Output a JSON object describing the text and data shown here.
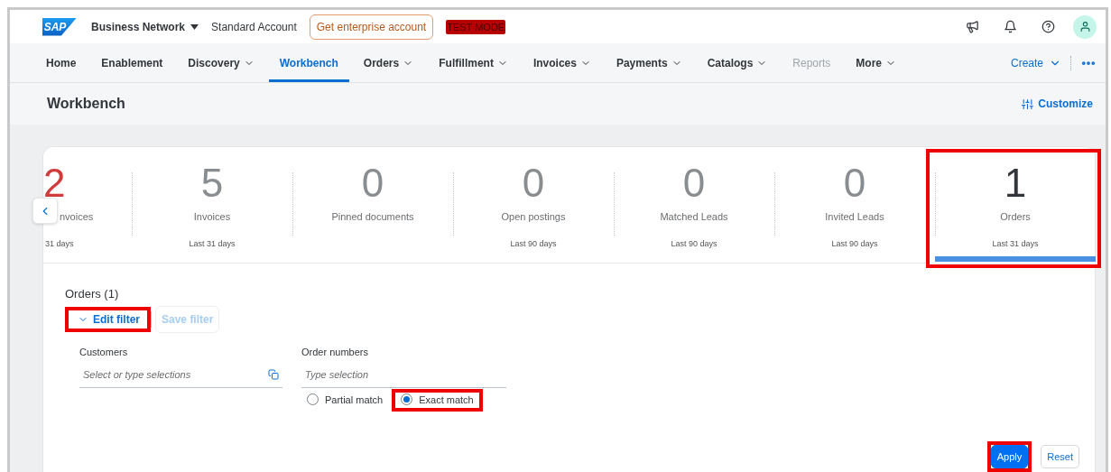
{
  "header": {
    "logo": "SAP",
    "product": "Business Network",
    "account": "Standard Account",
    "upgrade_button": "Get enterprise account",
    "mode_badge": "TEST MODE"
  },
  "nav": {
    "items": [
      {
        "label": "Home",
        "dropdown": false,
        "selected": false,
        "disabled": false
      },
      {
        "label": "Enablement",
        "dropdown": false,
        "selected": false,
        "disabled": false
      },
      {
        "label": "Discovery",
        "dropdown": true,
        "selected": false,
        "disabled": false
      },
      {
        "label": "Workbench",
        "dropdown": false,
        "selected": true,
        "disabled": false
      },
      {
        "label": "Orders",
        "dropdown": true,
        "selected": false,
        "disabled": false
      },
      {
        "label": "Fulfillment",
        "dropdown": true,
        "selected": false,
        "disabled": false
      },
      {
        "label": "Invoices",
        "dropdown": true,
        "selected": false,
        "disabled": false
      },
      {
        "label": "Payments",
        "dropdown": true,
        "selected": false,
        "disabled": false
      },
      {
        "label": "Catalogs",
        "dropdown": true,
        "selected": false,
        "disabled": false
      },
      {
        "label": "Reports",
        "dropdown": false,
        "selected": false,
        "disabled": true
      },
      {
        "label": "More",
        "dropdown": true,
        "selected": false,
        "disabled": false
      }
    ],
    "create": "Create"
  },
  "page_title": "Workbench",
  "customize": "Customize",
  "tiles": [
    {
      "count": "2",
      "label": "nvoices",
      "period": "31 days",
      "alert": true,
      "selected": false,
      "highlighted": false
    },
    {
      "count": "5",
      "label": "Invoices",
      "period": "Last 31 days",
      "alert": false,
      "selected": false,
      "highlighted": false
    },
    {
      "count": "0",
      "label": "Pinned documents",
      "alert": false,
      "selected": false,
      "highlighted": false
    },
    {
      "count": "0",
      "label": "Open postings",
      "period": "Last 90 days",
      "alert": false,
      "selected": false,
      "highlighted": false
    },
    {
      "count": "0",
      "label": "Matched Leads",
      "period": "Last 90 days",
      "alert": false,
      "selected": false,
      "highlighted": false
    },
    {
      "count": "0",
      "label": "Invited Leads",
      "period": "Last 90 days",
      "alert": false,
      "selected": false,
      "highlighted": false
    },
    {
      "count": "1",
      "label": "Orders",
      "period": "Last 31 days",
      "alert": false,
      "selected": true,
      "highlighted": true
    }
  ],
  "filter": {
    "title": "Orders (1)",
    "edit_button": {
      "label": "Edit filter",
      "highlighted": true
    },
    "save_button": {
      "label": "Save filter",
      "disabled": true
    },
    "fields": [
      {
        "kind": "multi-select",
        "label": "Customers",
        "placeholder": "Select or type selections"
      },
      {
        "kind": "text",
        "label": "Order numbers",
        "placeholder": "Type selection",
        "options": [
          {
            "label": "Partial match",
            "selected": false,
            "highlighted": false
          },
          {
            "label": "Exact match",
            "selected": true,
            "highlighted": true
          }
        ]
      }
    ]
  },
  "actions": [
    {
      "label": "Apply",
      "kind": "primary",
      "highlighted": true
    },
    {
      "label": "Reset",
      "kind": "secondary",
      "highlighted": false
    }
  ]
}
